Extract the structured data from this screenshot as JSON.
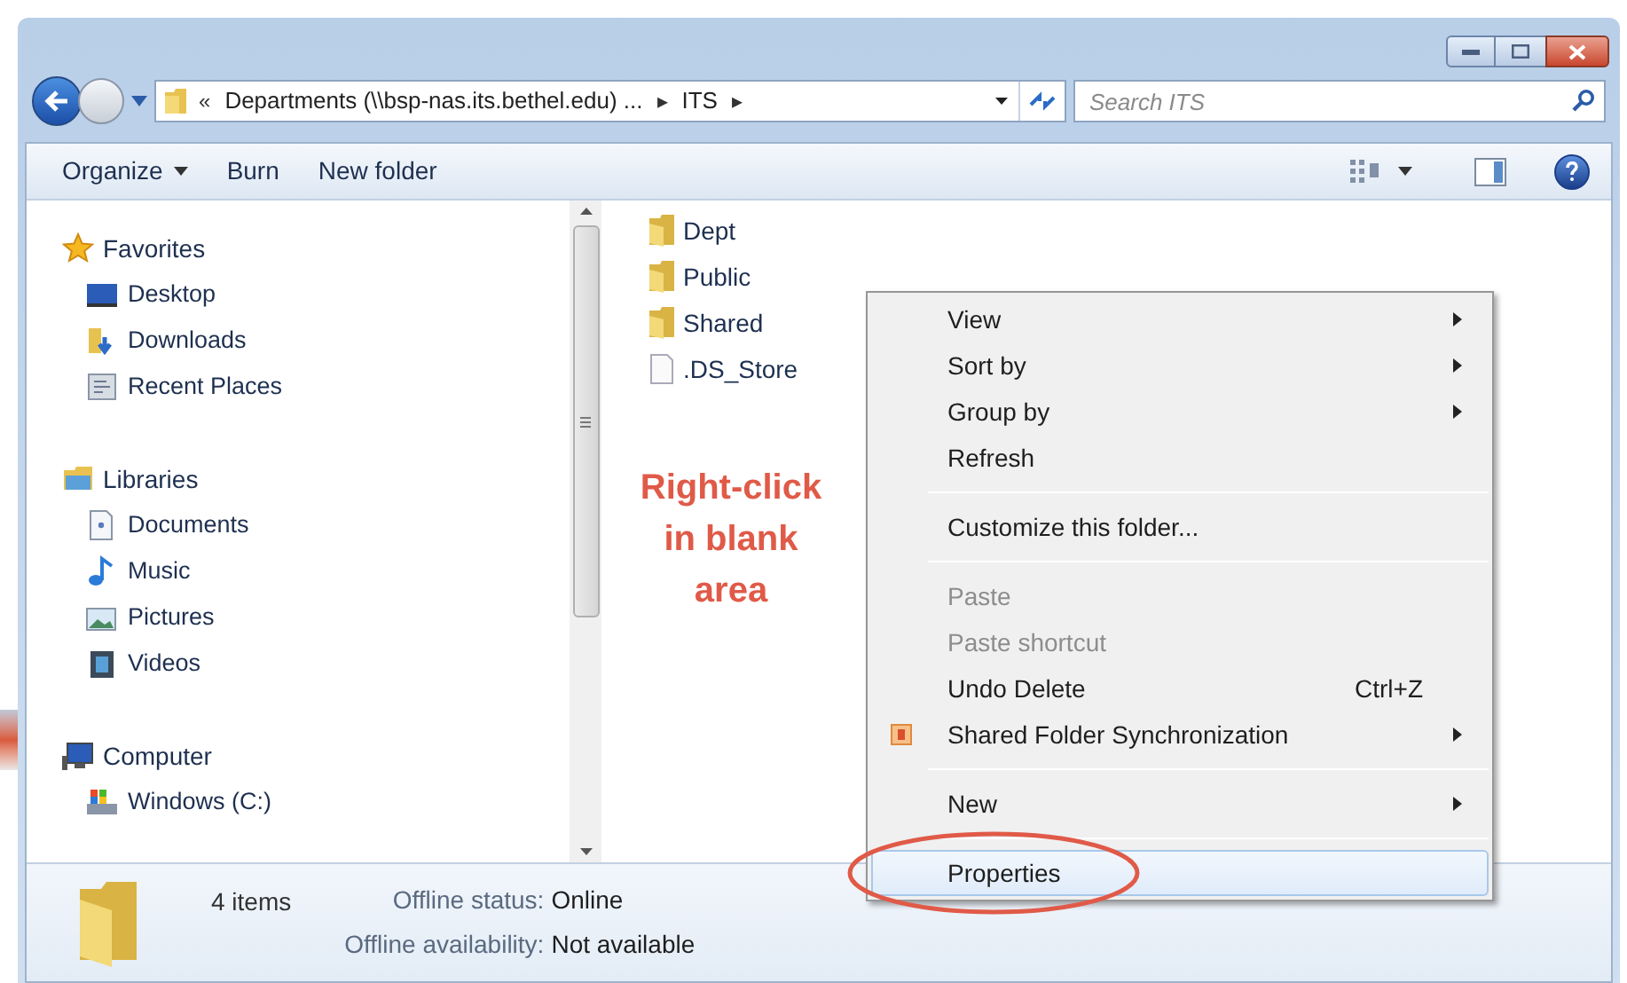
{
  "address_bar": {
    "segments": [
      "«",
      "Departments (\\\\bsp-nas.its.bethel.edu) ...",
      "▸",
      "ITS",
      "▸"
    ]
  },
  "search": {
    "placeholder": "Search ITS"
  },
  "toolbar": {
    "buttons": [
      {
        "label": "Organize",
        "dropdown": true
      },
      {
        "label": "Burn",
        "dropdown": false
      },
      {
        "label": "New folder",
        "dropdown": false
      }
    ]
  },
  "navigation": [
    {
      "label": "Favorites",
      "children": [
        {
          "label": "Desktop"
        },
        {
          "label": "Downloads"
        },
        {
          "label": "Recent Places"
        }
      ]
    },
    {
      "label": "Libraries",
      "children": [
        {
          "label": "Documents"
        },
        {
          "label": "Music"
        },
        {
          "label": "Pictures"
        },
        {
          "label": "Videos"
        }
      ]
    },
    {
      "label": "Computer",
      "children": [
        {
          "label": "Windows (C:)"
        }
      ]
    }
  ],
  "files": [
    {
      "name": "Dept",
      "kind": "folder"
    },
    {
      "name": "Public",
      "kind": "folder"
    },
    {
      "name": "Shared",
      "kind": "folder"
    },
    {
      "name": ".DS_Store",
      "kind": "file"
    }
  ],
  "annotation": "Right-click in blank area",
  "context_menu": [
    {
      "kind": "item",
      "label": "View",
      "submenu": true,
      "disabled": false,
      "selected": false
    },
    {
      "kind": "item",
      "label": "Sort by",
      "submenu": true,
      "disabled": false,
      "selected": false
    },
    {
      "kind": "item",
      "label": "Group by",
      "submenu": true,
      "disabled": false,
      "selected": false
    },
    {
      "kind": "item",
      "label": "Refresh",
      "submenu": false,
      "disabled": false,
      "selected": false
    },
    {
      "kind": "separator"
    },
    {
      "kind": "item",
      "label": "Customize this folder...",
      "submenu": false,
      "disabled": false,
      "selected": false
    },
    {
      "kind": "separator"
    },
    {
      "kind": "item",
      "label": "Paste",
      "submenu": false,
      "disabled": true,
      "selected": false
    },
    {
      "kind": "item",
      "label": "Paste shortcut",
      "submenu": false,
      "disabled": true,
      "selected": false
    },
    {
      "kind": "item",
      "label": "Undo Delete",
      "shortcut": "Ctrl+Z",
      "submenu": false,
      "disabled": false,
      "selected": false
    },
    {
      "kind": "item",
      "label": "Shared Folder Synchronization",
      "icon": true,
      "submenu": true,
      "disabled": false,
      "selected": false
    },
    {
      "kind": "separator"
    },
    {
      "kind": "item",
      "label": "New",
      "submenu": true,
      "disabled": false,
      "selected": false
    },
    {
      "kind": "separator"
    },
    {
      "kind": "item",
      "label": "Properties",
      "submenu": false,
      "disabled": false,
      "selected": true
    }
  ],
  "status_bar": {
    "count": "4 items",
    "details": [
      {
        "label": "Offline status:",
        "value": "Online"
      },
      {
        "label": "Offline availability:",
        "value": "Not available"
      }
    ]
  }
}
